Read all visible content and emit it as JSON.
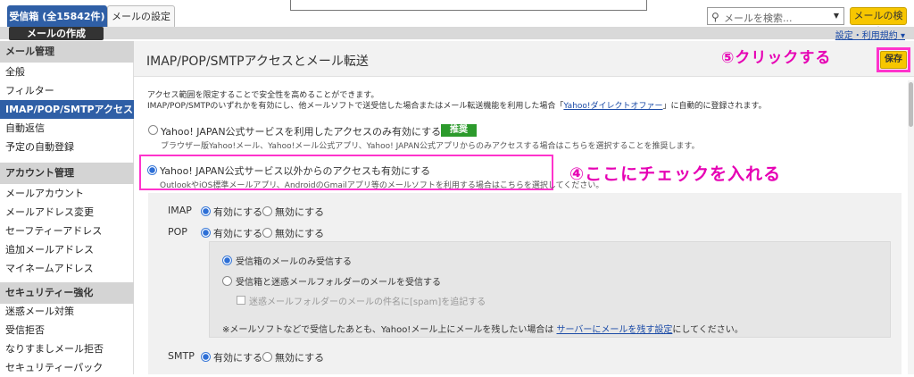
{
  "tabs": {
    "inbox": "受信箱 (全15842件)",
    "settings": "メールの設定"
  },
  "search": {
    "placeholder": "メールを検索...",
    "button": "メールの検索"
  },
  "compose": "メールの作成",
  "help_link": "設定・利用規約",
  "sidebar": {
    "sections": [
      {
        "title": "メール管理",
        "items": [
          "全般",
          "フィルター",
          "IMAP/POP/SMTPアクセスと…",
          "自動返信",
          "予定の自動登録"
        ]
      },
      {
        "title": "アカウント管理",
        "items": [
          "メールアカウント",
          "メールアドレス変更",
          "セーフティーアドレス",
          "追加メールアドレス",
          "マイネームアドレス"
        ]
      },
      {
        "title": "セキュリティー強化",
        "items": [
          "迷惑メール対策",
          "受信拒否",
          "なりすましメール拒否",
          "セキュリティーパック"
        ]
      }
    ],
    "active": "IMAP/POP/SMTPアクセスと…"
  },
  "main": {
    "title": "IMAP/POP/SMTPアクセスとメール転送",
    "save": "保存",
    "intro1": "アクセス範囲を限定することで安全性を高めることができます。",
    "intro2_pre": "IMAP/POP/SMTPのいずれかを有効にし、他メールソフトで送受信した場合またはメール転送機能を利用した場合「",
    "intro2_link": "Yahoo!ダイレクトオファー",
    "intro2_post": "」に自動的に登録されます。",
    "opt1_label": "Yahoo! JAPAN公式サービスを利用したアクセスのみ有効にする",
    "opt1_badge": "推奨",
    "opt1_desc": "ブラウザー版Yahoo!メール、Yahoo!メール公式アプリ、Yahoo! JAPAN公式アプリからのみアクセスする場合はこちらを選択することを推奨します。",
    "opt2_label": "Yahoo! JAPAN公式サービス以外からのアクセスも有効にする",
    "opt2_desc": "OutlookやiOS標準メールアプリ、AndroidのGmailアプリ等のメールソフトを利用する場合はこちらを選択してください。",
    "imap": {
      "label": "IMAP",
      "on": "有効にする",
      "off": "無効にする"
    },
    "pop": {
      "label": "POP",
      "on": "有効にする",
      "off": "無効にする"
    },
    "pop_inbox_only": "受信箱のメールのみ受信する",
    "pop_inbox_spam": "受信箱と迷惑メールフォルダーのメールを受信する",
    "pop_spam_tag": "迷惑メールフォルダーのメールの件名に[spam]を追記する",
    "note_pre": "※メールソフトなどで受信したあとも、Yahoo!メール上にメールを残したい場合は ",
    "note_link": "サーバーにメールを残す設定",
    "note_post": "にしてください。",
    "smtp": {
      "label": "SMTP",
      "on": "有効にする",
      "off": "無効にする"
    }
  },
  "annotations": {
    "step4": "④ここにチェックを入れる",
    "step5": "⑤クリックする"
  },
  "colors": {
    "accent_blue": "#2f5fa6",
    "annotation_pink": "#e600b4",
    "save_yellow": "#f7c600",
    "badge_green": "#2c9a2c"
  }
}
